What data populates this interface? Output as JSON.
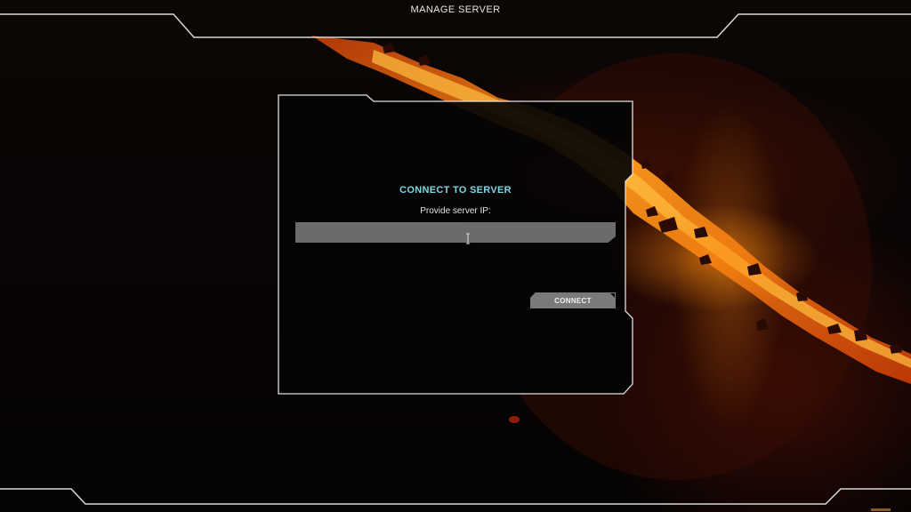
{
  "header": {
    "title": "MANAGE SERVER"
  },
  "dialog": {
    "title": "CONNECT TO SERVER",
    "label": "Provide server IP:",
    "input": {
      "value": "",
      "placeholder": ""
    },
    "connect_label": "CONNECT"
  },
  "colors": {
    "accent": "#7fd6e2",
    "frame": "#d8d8d8",
    "input_bg": "#6b6b6b",
    "button_bg": "#7a7a7a",
    "lava": "#ff9a1a"
  },
  "icons": {
    "cursor": "text-cursor-icon"
  }
}
